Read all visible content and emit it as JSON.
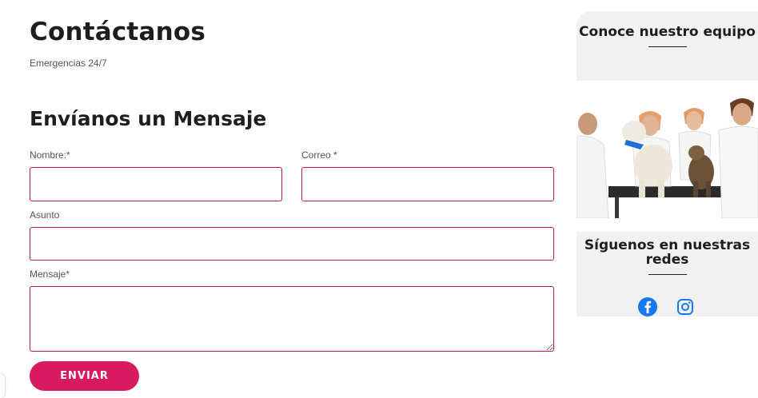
{
  "header": {
    "title": "Contáctanos",
    "subtitle": "Emergencias 24/7"
  },
  "form": {
    "title": "Envíanos un Mensaje",
    "name_label": "Nombre:*",
    "email_label": "Correo *",
    "subject_label": "Asunto",
    "message_label": "Mensaje*",
    "submit_label": "ENVIAR"
  },
  "sidebar": {
    "team_title": "Conoce nuestro equipo",
    "social_title": "Síguenos en nuestras redes",
    "social_icons": [
      "facebook-icon",
      "instagram-icon"
    ]
  },
  "colors": {
    "accent": "#d81b60",
    "field_border": "#c2185b",
    "card_bg": "#f1f1f1",
    "social_blue": "#1877f2"
  }
}
